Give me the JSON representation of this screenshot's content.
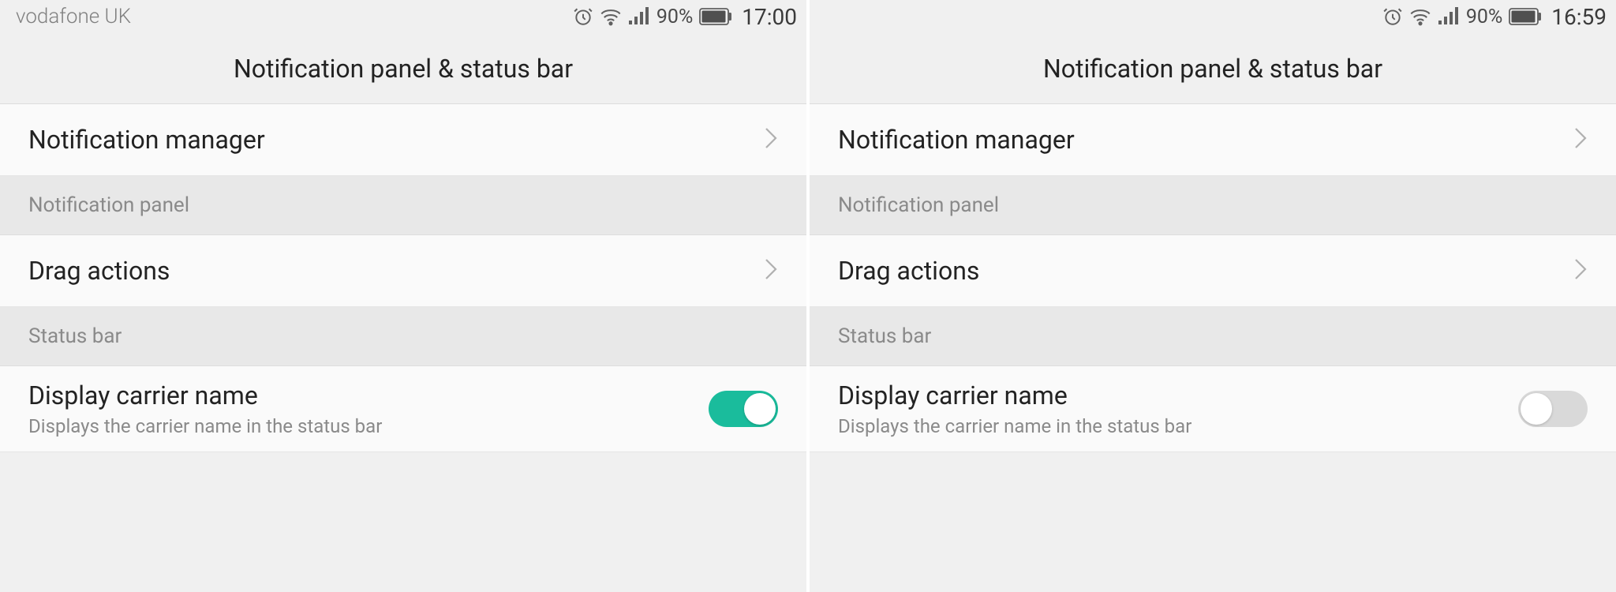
{
  "left": {
    "status_bar": {
      "carrier": "vodafone UK",
      "battery_percent": "90%",
      "time": "17:00"
    },
    "header": {
      "title": "Notification panel & status bar"
    },
    "items": {
      "notification_manager": "Notification manager",
      "section_notification_panel": "Notification panel",
      "drag_actions": "Drag actions",
      "section_status_bar": "Status bar",
      "display_carrier_name": "Display carrier name",
      "display_carrier_subtitle": "Displays the carrier name in the status bar"
    },
    "toggle_state": "on"
  },
  "right": {
    "status_bar": {
      "carrier": "",
      "battery_percent": "90%",
      "time": "16:59"
    },
    "header": {
      "title": "Notification panel & status bar"
    },
    "items": {
      "notification_manager": "Notification manager",
      "section_notification_panel": "Notification panel",
      "drag_actions": "Drag actions",
      "section_status_bar": "Status bar",
      "display_carrier_name": "Display carrier name",
      "display_carrier_subtitle": "Displays the carrier name in the status bar"
    },
    "toggle_state": "off"
  }
}
